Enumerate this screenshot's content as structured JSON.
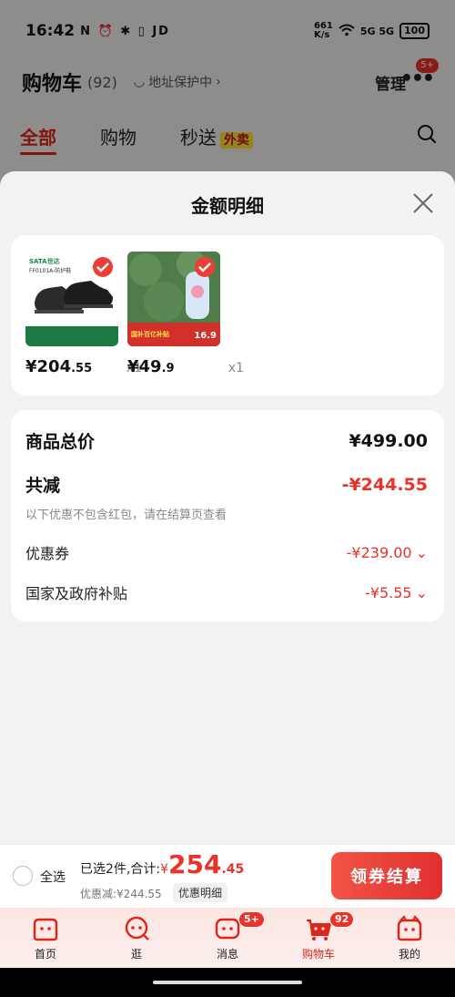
{
  "status_bar": {
    "time": "16:42",
    "left_icons": "N ⏰ ✱ ▯ JD",
    "net_speed": "661\nK/s",
    "signal": "5G 5G",
    "battery": "100"
  },
  "cart_header": {
    "title": "购物车",
    "count": "(92)",
    "address": "地址保护中",
    "manage": "管理",
    "more_badge": "5+"
  },
  "tabs": [
    {
      "label": "全部",
      "active": true
    },
    {
      "label": "购物",
      "active": false
    },
    {
      "label": "秒送",
      "active": false,
      "badge": "外卖"
    }
  ],
  "sheet": {
    "title": "金额明细",
    "products": [
      {
        "price_int": "¥204",
        "price_dec": ".55",
        "qty": "x1",
        "brand": "SATA世达",
        "image_caption": "FF0101A-防护鞋"
      },
      {
        "price_int": "¥49",
        "price_dec": ".9",
        "qty": "x1",
        "image_caption": "国补百亿补贴",
        "image_price": "16.9"
      }
    ],
    "details": {
      "total_label": "商品总价",
      "total_value": "¥499.00",
      "reduce_label": "共减",
      "reduce_value": "-¥244.55",
      "note": "以下优惠不包含红包，请在结算页查看",
      "coupon_label": "优惠券",
      "coupon_value": "-¥239.00",
      "subsidy_label": "国家及政府补贴",
      "subsidy_value": "-¥5.55"
    }
  },
  "checkout": {
    "select_all": "全选",
    "selected_text": "已选2件,合计:",
    "currency": "¥",
    "total_int": "254",
    "total_dec": ".45",
    "saved": "优惠减:¥244.55",
    "detail_chip": "优惠明细",
    "pay_button": "领券结算"
  },
  "bottom_nav": [
    {
      "label": "首页",
      "icon": "home-icon"
    },
    {
      "label": "逛",
      "icon": "browse-icon"
    },
    {
      "label": "消息",
      "icon": "message-icon",
      "badge": "5+"
    },
    {
      "label": "购物车",
      "icon": "cart-icon",
      "badge": "92",
      "active": true
    },
    {
      "label": "我的",
      "icon": "profile-icon"
    }
  ],
  "colors": {
    "accent": "#e8322a",
    "brand_red": "#e2231a",
    "sheet_bg": "#f2f2f2"
  }
}
